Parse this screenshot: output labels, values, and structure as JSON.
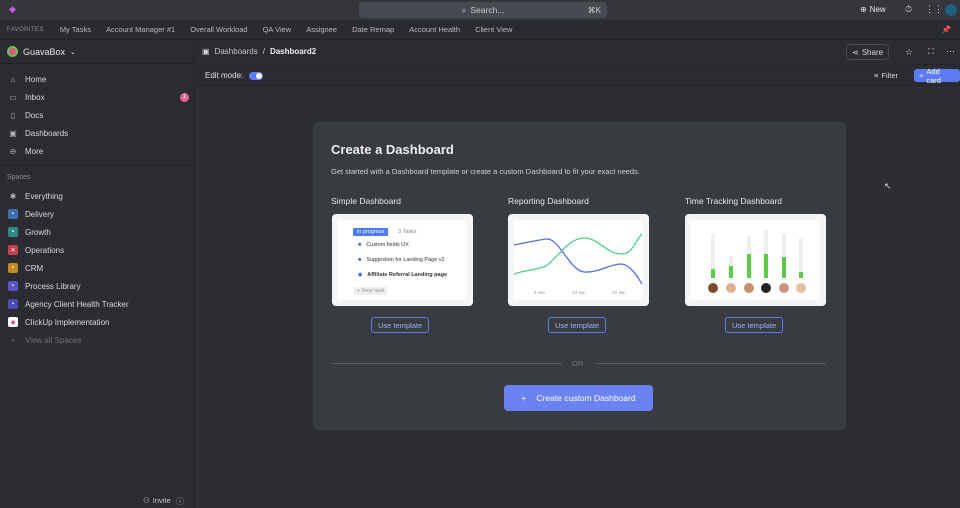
{
  "topbar": {
    "search_placeholder": "Search...",
    "search_shortcut": "⌘K",
    "new_label": "New"
  },
  "favorites": {
    "label": "FAVORITES",
    "items": [
      "My Tasks",
      "Account Manager #1",
      "Overall Workload",
      "QA View",
      "Assignee",
      "Date Remap",
      "Account Health",
      "Client View"
    ]
  },
  "sidebar": {
    "workspace": "GuavaBox",
    "nav": [
      {
        "label": "Home"
      },
      {
        "label": "Inbox",
        "badge": "1"
      },
      {
        "label": "Docs"
      },
      {
        "label": "Dashboards"
      },
      {
        "label": "More"
      }
    ],
    "spaces_label": "Spaces",
    "spaces": [
      {
        "label": "Everything",
        "color": "#2a2c31"
      },
      {
        "label": "Delivery",
        "color": "#3b6fb0"
      },
      {
        "label": "Growth",
        "color": "#2a8c84"
      },
      {
        "label": "Operations",
        "color": "#c0404f"
      },
      {
        "label": "CRM",
        "color": "#c08a1e"
      },
      {
        "label": "Process Library",
        "color": "#5a55c8"
      },
      {
        "label": "Agency Client Health Tracker",
        "color": "#4e4bb8"
      },
      {
        "label": "ClickUp Implementation",
        "color": "#ffffff"
      }
    ],
    "view_all": "View all Spaces",
    "invite": "Invite"
  },
  "header": {
    "breadcrumb_parent": "Dashboards",
    "breadcrumb_sep": "/",
    "title": "Dashboard2",
    "share": "Share"
  },
  "editbar": {
    "edit_mode_label": "Edit mode:",
    "edit_mode": true,
    "filter": "Filter",
    "add_card": "Add card"
  },
  "create": {
    "title": "Create a Dashboard",
    "subtitle": "Get started with a Dashboard template or create a custom Dashboard to fit your exact needs.",
    "templates": [
      {
        "title": "Simple Dashboard",
        "button": "Use template"
      },
      {
        "title": "Reporting Dashboard",
        "button": "Use template"
      },
      {
        "title": "Time Tracking Dashboard",
        "button": "Use template"
      }
    ],
    "simple_preview": {
      "status": "in progress",
      "count": "3 Tasks",
      "tasks": [
        "Custom fields UX",
        "Suggestion for Landing Page v2",
        "Affiliate Referral Landing page"
      ],
      "new_task": "+ New task"
    },
    "reporting_preview": {
      "x_labels": [
        "6 Jan",
        "13 Jan",
        "20 Jan"
      ]
    },
    "or": "OR",
    "custom_button": "Create custom Dashboard"
  },
  "colors": {
    "accent": "#6b83f0",
    "badge": "#e5658f"
  }
}
